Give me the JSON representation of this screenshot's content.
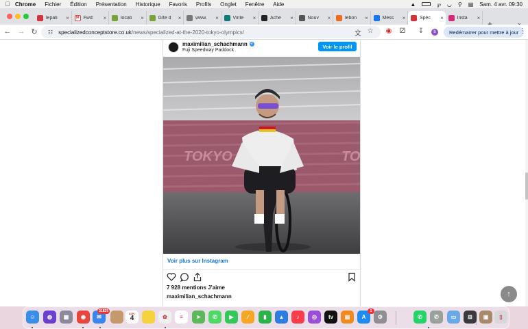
{
  "menubar": {
    "app_name": "Chrome",
    "items": [
      "Fichier",
      "Édition",
      "Présentation",
      "Historique",
      "Favoris",
      "Profils",
      "Onglet",
      "Fenêtre",
      "Aide"
    ],
    "clock": "Sam. 4 avr.  09:30"
  },
  "tabs": [
    {
      "title": "lepati",
      "fav_color": "#d2343a",
      "fav_icon": "v-logo-icon"
    },
    {
      "title": "Fwd:",
      "fav_color": "#ffffff",
      "fav_icon": "gmail-icon"
    },
    {
      "title": "locati",
      "fav_color": "#7aa13a",
      "fav_icon": "location-icon"
    },
    {
      "title": "Gîte d",
      "fav_color": "#7aa13a",
      "fav_icon": "location-icon"
    },
    {
      "title": "www.",
      "fav_color": "#777777",
      "fav_icon": "globe-icon"
    },
    {
      "title": "Vinte",
      "fav_color": "#0f7a7a",
      "fav_icon": "vinted-icon"
    },
    {
      "title": "Ache",
      "fav_color": "#222222",
      "fav_icon": "bc-icon"
    },
    {
      "title": "Nouv",
      "fav_color": "#555555",
      "fav_icon": "github-icon"
    },
    {
      "title": "lebon",
      "fav_color": "#f06b1e",
      "fav_icon": "leboncoin-icon"
    },
    {
      "title": "Mess",
      "fav_color": "#1877f2",
      "fav_icon": "facebook-icon"
    },
    {
      "title": "Spéc",
      "fav_color": "#d2343a",
      "fav_icon": "specialized-icon",
      "active": true
    },
    {
      "title": "Insta",
      "fav_color": "#d62976",
      "fav_icon": "instagram-icon"
    }
  ],
  "toolbar": {
    "url_host": "specializedconceptstore.co.uk",
    "url_path": "/news/specialized-at-the-2020-tokyo-olympics/",
    "profile_letter": "b",
    "restart_label": "Redémarrer pour mettre à jour"
  },
  "instagram": {
    "username": "maximilian_schachmann",
    "location": "Fuji Speedway Paddock",
    "follow_label": "Voir le profil",
    "photo_banner_text": "TOKYO 2020",
    "more_label": "Voir plus sur Instagram",
    "likes": "7 928 mentions J’aime",
    "caption_user": "maximilian_schachmann"
  },
  "dock": {
    "mail_badge": "31829",
    "calendar_month": "AVR.",
    "calendar_day": "4",
    "appstore_badge": "1",
    "apps": [
      "finder-icon",
      "siri-icon",
      "launchpad-icon",
      "chrome-icon",
      "mail-icon",
      "contacts-icon",
      "calendar-icon",
      "notes-icon",
      "photos-icon",
      "reminders-icon",
      "maps-icon",
      "messages-icon",
      "facetime-icon",
      "freeform-icon",
      "numbers-icon",
      "keynote-icon",
      "music-icon",
      "podcasts-icon",
      "appletv-icon",
      "books-icon",
      "appstore-icon",
      "settings-icon",
      "whatsapp-icon",
      "whatsapp2-icon",
      "preview-icon",
      "calculator-icon",
      "photo-stack-icon",
      "trash-icon"
    ]
  }
}
